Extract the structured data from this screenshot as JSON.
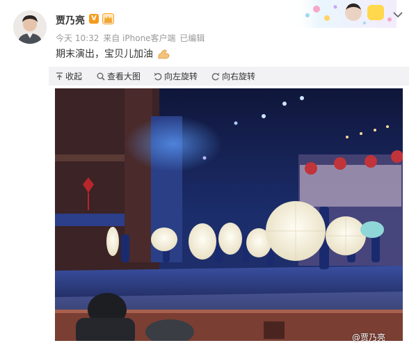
{
  "post": {
    "author": "贾乃亮",
    "verified_badge": "V",
    "time": "今天 10:32",
    "source": "来自 iPhone客户端",
    "edited": "已编辑",
    "text": "期末演出，宝贝儿加油"
  },
  "toolbar": {
    "collapse": "收起",
    "view_large": "查看大图",
    "rotate_left": "向左旋转",
    "rotate_right": "向右旋转"
  },
  "image": {
    "watermark": "@贾乃亮"
  },
  "icons": {
    "verified": "verified-v-icon",
    "vip": "crown-icon",
    "flex": "flexed-biceps-icon",
    "more": "chevron-down-icon"
  },
  "colors": {
    "badge": "#f59b1b",
    "toolbar_bg": "#f2f2f5",
    "meta_text": "#999999"
  }
}
